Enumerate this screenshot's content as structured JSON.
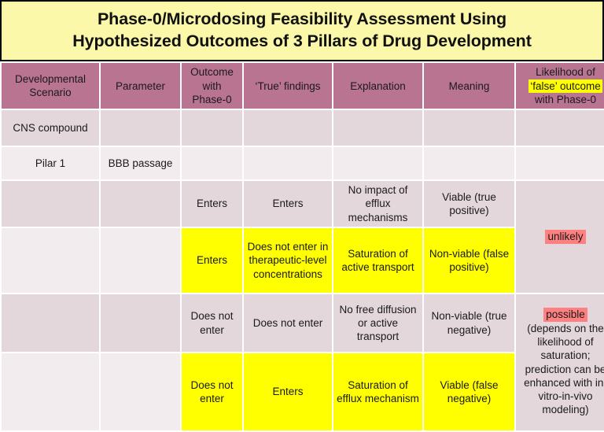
{
  "title": {
    "line1": "Phase-0/Microdosing Feasibility Assessment Using",
    "line2": "Hypothesized Outcomes of 3 Pillars of Drug Development"
  },
  "colors": {
    "title_background": "#FBF8A9",
    "header_background": "#B97491",
    "header_text": "#FFFFFF",
    "row_dark": "#E3D7DC",
    "row_light": "#F2ECEF",
    "highlight_yellow": "#FFFF00",
    "highlight_red": "#FF8080",
    "page_background": "#000000"
  },
  "table": {
    "headers": {
      "col1": "Developmental Scenario",
      "col2": "Parameter",
      "col3": "Outcome with Phase-0",
      "col4": "‘True’ findings",
      "col5": "Explanation",
      "col6": "Meaning",
      "col7_line1": "Likelihood of",
      "col7_line2": "‘false’ outcome",
      "col7_line3": "with Phase-0"
    },
    "rows": [
      {
        "scenario": "CNS compound",
        "parameter": "",
        "outcome": "",
        "true_findings": "",
        "explanation": "",
        "meaning": ""
      },
      {
        "scenario": "Pilar 1",
        "parameter": "BBB passage",
        "outcome": "",
        "true_findings": "",
        "explanation": "",
        "meaning": ""
      },
      {
        "scenario": "",
        "parameter": "",
        "outcome": "Enters",
        "true_findings": "Enters",
        "explanation": "No impact of efflux mechanisms",
        "meaning": "Viable (true positive)"
      },
      {
        "scenario": "",
        "parameter": "",
        "outcome": "Enters",
        "true_findings": "Does not enter in therapeutic-level concentrations",
        "explanation": "Saturation of active transport",
        "meaning": "Non-viable (false positive)"
      },
      {
        "scenario": "",
        "parameter": "",
        "outcome": "Does not enter",
        "true_findings": "Does not enter",
        "explanation": "No free diffusion or active transport",
        "meaning": "Non-viable (true negative)"
      },
      {
        "scenario": "",
        "parameter": "",
        "outcome": "Does not enter",
        "true_findings": "Enters",
        "explanation": "Saturation of efflux mechanism",
        "meaning": "Viable (false negative)"
      }
    ],
    "likelihood": {
      "group1_keyword": "unlikely",
      "group1_detail": "",
      "group2_keyword": "possible",
      "group2_detail": "(depends on the likelihood of saturation; prediction can be enhanced with in-vitro-in-vivo modeling)"
    }
  }
}
